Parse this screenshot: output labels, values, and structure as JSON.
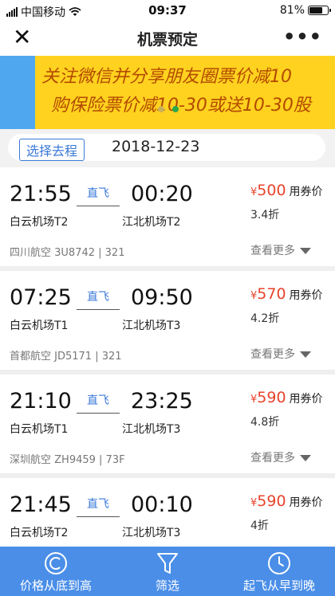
{
  "status_bar": {
    "carrier": "中国移动",
    "time": "09:37",
    "battery": "81%",
    "battery_level": 0.81
  },
  "nav": {
    "close_icon": "close-icon",
    "title": "机票预定",
    "more": "•••"
  },
  "banner": {
    "line1": "关注微信并分享朋友圈票价减10",
    "line2": "购保险票价减10-30或送10-30股",
    "colors": {
      "background": "#ffd21f",
      "text": "#b34a00",
      "side": "#4fa8ef"
    }
  },
  "trip": {
    "select_label": "选择去程",
    "date": "2018-12-23"
  },
  "flights": [
    {
      "dep_time": "21:55",
      "arr_time": "00:20",
      "direct": "直飞",
      "dep_airport": "白云机场T2",
      "arr_airport": "江北机场T2",
      "yen": "¥",
      "price": "500",
      "price_label": "用券价",
      "discount": "3.4折",
      "airline": "四川航空 3U8742 | 321",
      "more": "查看更多"
    },
    {
      "dep_time": "07:25",
      "arr_time": "09:50",
      "direct": "直飞",
      "dep_airport": "白云机场T1",
      "arr_airport": "江北机场T3",
      "yen": "¥",
      "price": "570",
      "price_label": "用券价",
      "discount": "4.2折",
      "airline": "首都航空 JD5171 | 321",
      "more": "查看更多"
    },
    {
      "dep_time": "21:10",
      "arr_time": "23:25",
      "direct": "直飞",
      "dep_airport": "白云机场T1",
      "arr_airport": "江北机场T3",
      "yen": "¥",
      "price": "590",
      "price_label": "用券价",
      "discount": "4.8折",
      "airline": "深圳航空 ZH9459 | 73F",
      "more": "查看更多"
    },
    {
      "dep_time": "21:45",
      "arr_time": "00:10",
      "direct": "直飞",
      "dep_airport": "白云机场T2",
      "arr_airport": "江北机场T3",
      "yen": "¥",
      "price": "590",
      "price_label": "用券价",
      "discount": "4折",
      "airline": "",
      "more": ""
    }
  ],
  "toolbar": {
    "sort_price": "价格从底到高",
    "filter": "筛选",
    "sort_time": "起飞从早到晚",
    "color": "#4a8ee8"
  },
  "colors": {
    "accent": "#3a7ad8",
    "price": "#e8432c"
  }
}
